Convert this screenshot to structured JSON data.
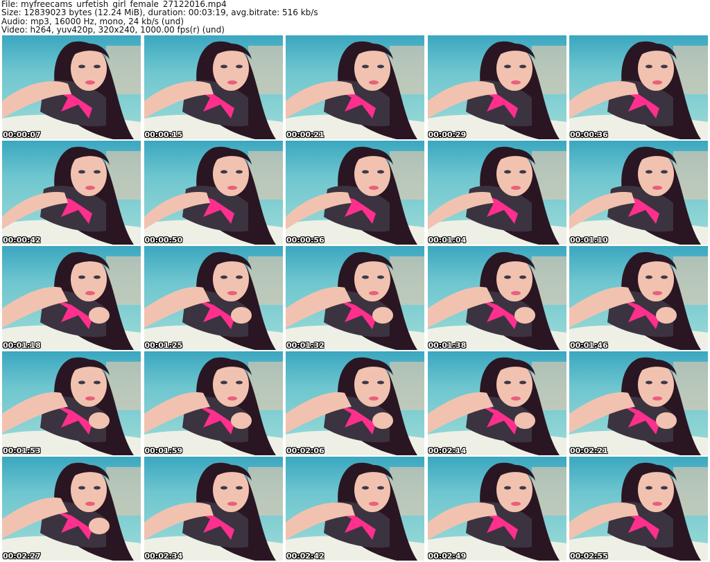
{
  "header": {
    "file": "File: myfreecams_urfetish_girl_female_27122016.mp4",
    "size": "Size: 12839023 bytes (12.24 MiB), duration: 00:03:19, avg.bitrate: 516 kb/s",
    "audio": "Audio: mp3, 16000 Hz, mono, 24 kb/s (und)",
    "video": "Video: h264, yuv420p, 320x240, 1000.00 fps(r) (und)"
  },
  "thumbnails": [
    {
      "timestamp": "00:00:07",
      "pose": "A"
    },
    {
      "timestamp": "00:00:15",
      "pose": "A"
    },
    {
      "timestamp": "00:00:21",
      "pose": "A"
    },
    {
      "timestamp": "00:00:29",
      "pose": "A"
    },
    {
      "timestamp": "00:00:36",
      "pose": "A"
    },
    {
      "timestamp": "00:00:42",
      "pose": "B"
    },
    {
      "timestamp": "00:00:50",
      "pose": "B"
    },
    {
      "timestamp": "00:00:56",
      "pose": "B"
    },
    {
      "timestamp": "00:01:04",
      "pose": "B"
    },
    {
      "timestamp": "00:01:10",
      "pose": "B"
    },
    {
      "timestamp": "00:01:18",
      "pose": "C"
    },
    {
      "timestamp": "00:01:25",
      "pose": "C"
    },
    {
      "timestamp": "00:01:32",
      "pose": "C"
    },
    {
      "timestamp": "00:01:38",
      "pose": "C"
    },
    {
      "timestamp": "00:01:46",
      "pose": "C"
    },
    {
      "timestamp": "00:01:53",
      "pose": "C"
    },
    {
      "timestamp": "00:01:59",
      "pose": "C"
    },
    {
      "timestamp": "00:02:06",
      "pose": "C"
    },
    {
      "timestamp": "00:02:14",
      "pose": "C"
    },
    {
      "timestamp": "00:02:21",
      "pose": "C"
    },
    {
      "timestamp": "00:02:27",
      "pose": "C"
    },
    {
      "timestamp": "00:02:34",
      "pose": "A"
    },
    {
      "timestamp": "00:02:42",
      "pose": "A"
    },
    {
      "timestamp": "00:02:49",
      "pose": "A"
    },
    {
      "timestamp": "00:02:55",
      "pose": "A"
    }
  ],
  "colors": {
    "background_teal": "#6fc6cf",
    "hair": "#2a1622",
    "skin": "#f2c2b0",
    "top_pink": "#ff2f8e",
    "top_dark": "#3c3340",
    "blanket": "#eef0e6",
    "timestamp_text": "#ffffff"
  }
}
